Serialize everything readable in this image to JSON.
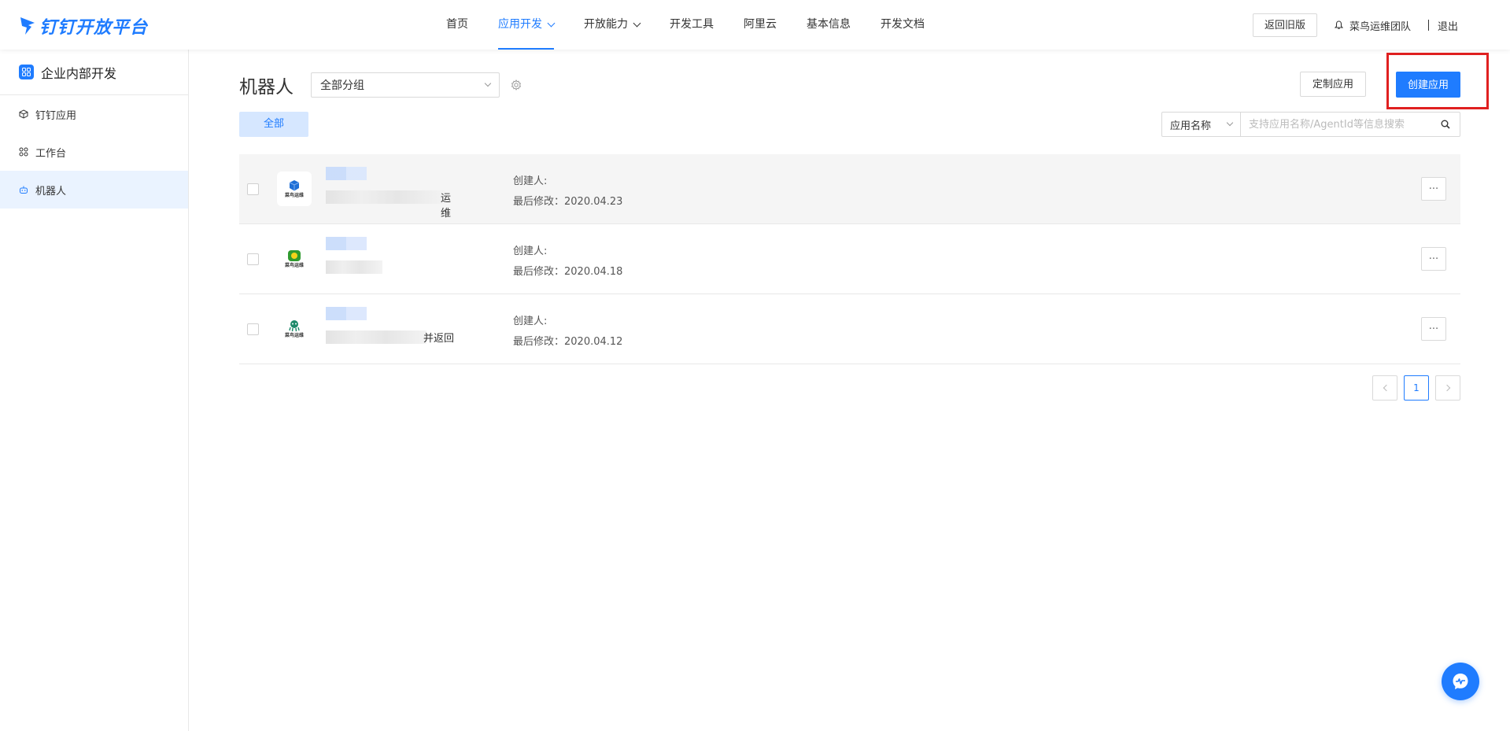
{
  "header": {
    "logo_text": "钉钉开放平台",
    "nav": [
      {
        "label": "首页",
        "active": false,
        "dropdown": false
      },
      {
        "label": "应用开发",
        "active": true,
        "dropdown": true
      },
      {
        "label": "开放能力",
        "active": false,
        "dropdown": true
      },
      {
        "label": "开发工具",
        "active": false,
        "dropdown": false
      },
      {
        "label": "阿里云",
        "active": false,
        "dropdown": false
      },
      {
        "label": "基本信息",
        "active": false,
        "dropdown": false
      },
      {
        "label": "开发文档",
        "active": false,
        "dropdown": false
      }
    ],
    "old_version_label": "返回旧版",
    "team_name": "菜鸟运维团队",
    "logout_label": "退出"
  },
  "sidebar": {
    "title": "企业内部开发",
    "items": [
      {
        "label": "钉钉应用",
        "icon": "cube-icon",
        "active": false
      },
      {
        "label": "工作台",
        "icon": "grid-icon",
        "active": false
      },
      {
        "label": "机器人",
        "icon": "robot-icon",
        "active": true
      }
    ]
  },
  "main": {
    "title": "机器人",
    "group_select": "全部分组",
    "custom_app_label": "定制应用",
    "create_app_label": "创建应用",
    "tab_all": "全部",
    "search_type": "应用名称",
    "search_placeholder": "支持应用名称/AgentId等信息搜索",
    "rows": [
      {
        "name_tail": "运维",
        "creator_label": "创建人:",
        "modified": "最后修改：2020.04.23",
        "icon_color": "#1f6fd6"
      },
      {
        "name_tail": "",
        "creator_label": "创建人:",
        "modified": "最后修改：2020.04.18",
        "icon_color": "#2f9a2f"
      },
      {
        "name_tail": "并返回",
        "creator_label": "创建人:",
        "modified": "最后修改：2020.04.12",
        "icon_color": "#1e8a6a"
      }
    ],
    "icon_brand": "菜鸟运维",
    "more_label": "···",
    "pagination": {
      "current": "1"
    }
  },
  "colors": {
    "accent": "#1f7cff",
    "highlight_box": "#e02020"
  }
}
